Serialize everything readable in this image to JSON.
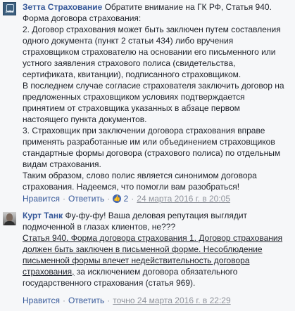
{
  "comment1": {
    "author": "Зетта Страхование",
    "lines": [
      " Обратите внимание на ГК РФ, Статья 940.",
      "Форма договора страхования:",
      "2. Договор страхования может быть заключен путем составления",
      "одного документа (пункт 2 статьи 434) либо вручения",
      "страховщиком страхователю на основании его письменного или",
      "устного заявления страхового полиса (свидетельства,",
      "сертификата, квитанции), подписанного страховщиком.",
      "В последнем случае согласие страхователя заключить договор на",
      "предложенных страховщиком условиях подтверждается",
      "принятием от страховщика указанных в абзаце первом",
      "настоящего пункта документов.",
      "3. Страховщик при заключении договора страхования вправе",
      "применять разработанные им или объединением страховщиков",
      "стандартные формы договора (страхового полиса) по отдельным",
      "видам страхования.",
      "Таким образом, слово полис является синонимом договора",
      "страхования. Надеемся, что помогли вам разобраться!"
    ],
    "actions": [
      "Нравится",
      "Ответить"
    ],
    "likes": "2",
    "time": "24 марта 2016 г. в 20:05",
    "separator": "·"
  },
  "comment2": {
    "author": "Курт Танк",
    "first_line": " Фу-фу-фу! Ваша деловая репутация выглядит",
    "lines_plain": [
      "подмоченной в глазах клиентов, не???"
    ],
    "lines_link": [
      "Статья 940. Форма договора страхования 1. Договор страхования",
      "должен быть заключен в письменной форме. Несоблюдение",
      "письменной формы влечет недействительность договора",
      "страхования,"
    ],
    "link_tail": " за исключением договора обязательного",
    "lines_after": [
      "государственного страхования (статья 969)."
    ],
    "actions": [
      "Нравится",
      "Ответить"
    ],
    "time": "точно 24 марта 2016 г. в 22:29",
    "separator": "·"
  },
  "colors": {
    "author": "#365899",
    "text": "#1d2129",
    "meta": "#90949c",
    "background": "#f6f7f9"
  }
}
